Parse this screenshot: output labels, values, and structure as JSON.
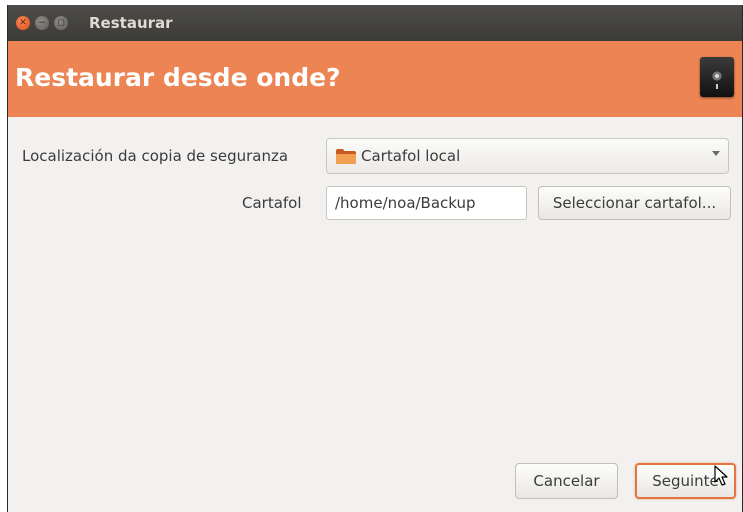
{
  "window": {
    "title": "Restaurar",
    "controls": [
      "close-icon",
      "minimize-icon",
      "maximize-icon"
    ]
  },
  "header": {
    "title": "Restaurar desde onde?",
    "icon": "safe-icon"
  },
  "form": {
    "location_label": "Localización da copia de seguranza",
    "location_value": "Cartafol local",
    "location_icon": "folder-icon",
    "folder_label": "Cartafol",
    "folder_value": "/home/noa/Backup",
    "select_folder_button": "Seleccionar cartafol..."
  },
  "footer": {
    "cancel_button": "Cancelar",
    "next_button": "Seguinte"
  },
  "colors": {
    "accent": "#ed8453",
    "titlebar": "#3c3b37",
    "focus_border": "#e5753f"
  }
}
